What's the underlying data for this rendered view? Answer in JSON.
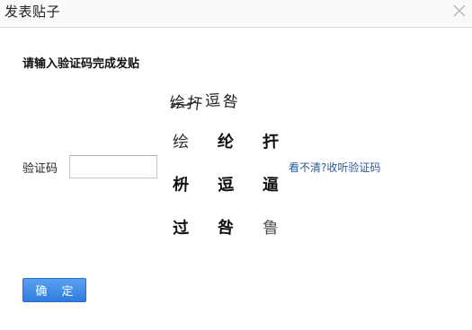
{
  "dialog": {
    "title": "发表贴子",
    "close_icon": "close-icon"
  },
  "form": {
    "prompt": "请输入验证码完成发贴",
    "captcha_label": "验证码",
    "captcha_input_value": "",
    "captcha_input_placeholder": "",
    "target_sequence": [
      "绘",
      "扞",
      "逗",
      "咎"
    ],
    "grid": [
      [
        "绘",
        "纶",
        "扞"
      ],
      [
        "枡",
        "逗",
        "逼"
      ],
      [
        "过",
        "咎",
        "鲁"
      ]
    ],
    "refresh_link": "看不清?收听验证码",
    "confirm_button": "确 定"
  },
  "colors": {
    "link": "#2b5b9a",
    "button": "#3580e4",
    "titlebar_border": "#d9d9d9"
  }
}
